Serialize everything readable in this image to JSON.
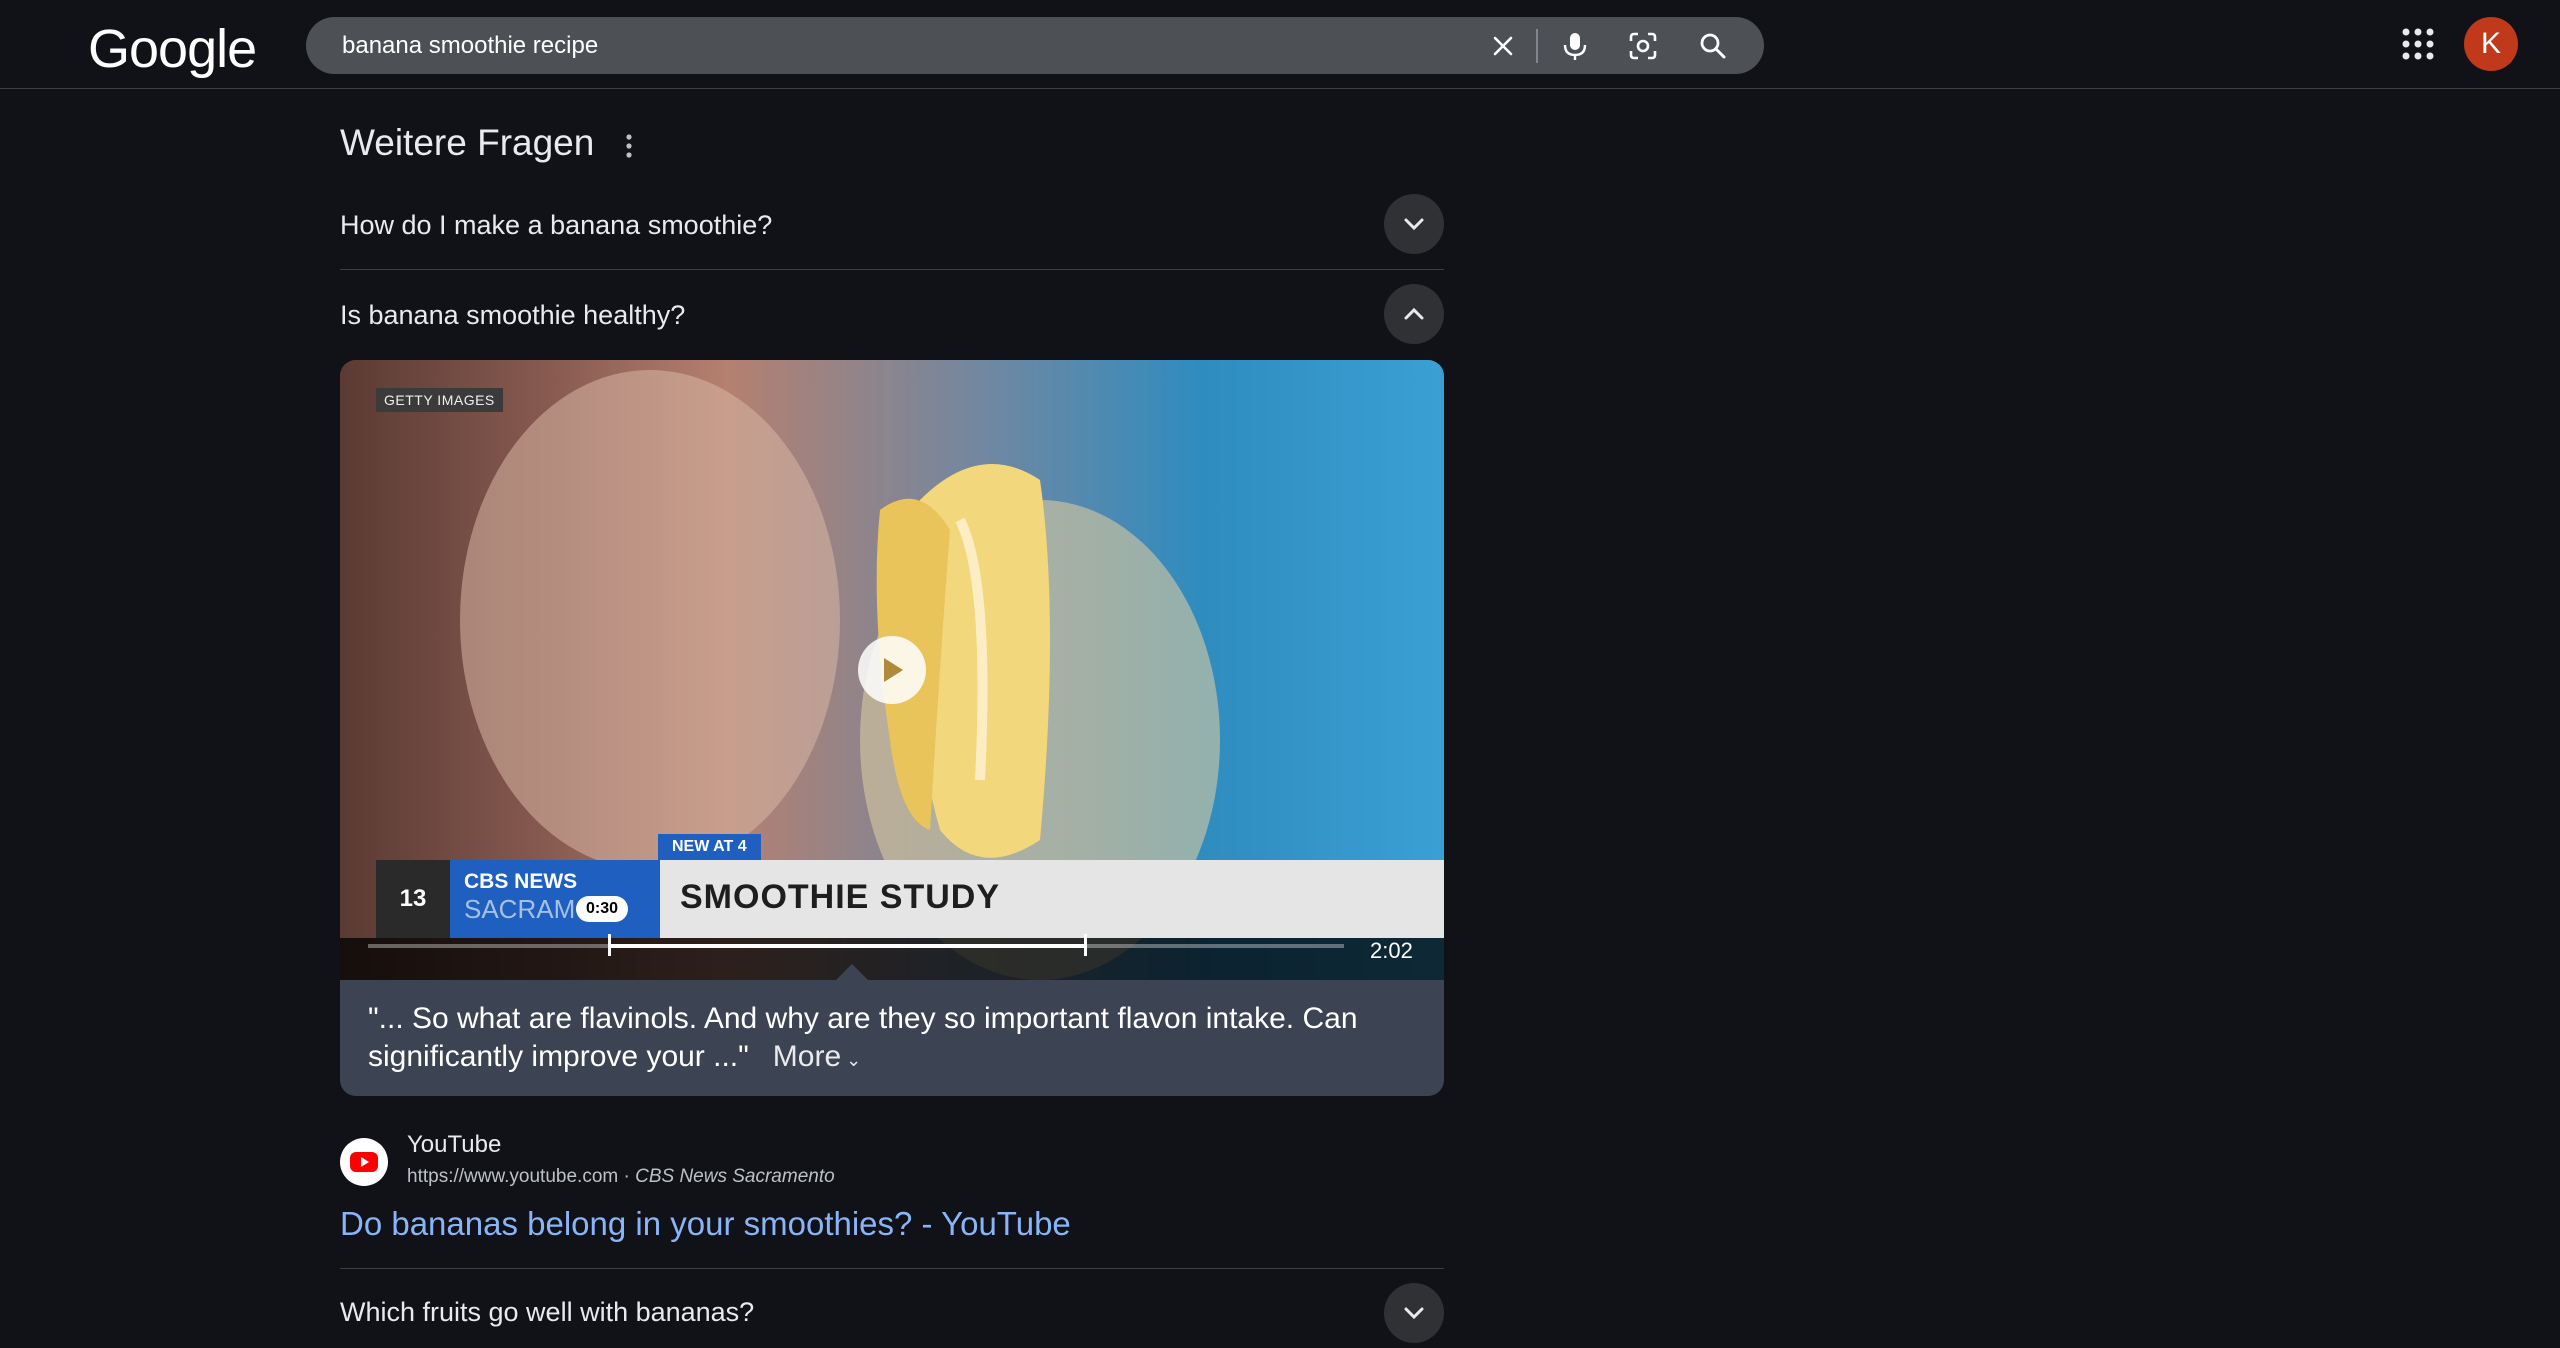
{
  "header": {
    "logo": "Google",
    "search_query": "banana smoothie recipe",
    "avatar_letter": "K"
  },
  "paa": {
    "title": "Weitere Fragen",
    "questions": [
      {
        "text": "How do I make a banana smoothie?",
        "state": "collapsed"
      },
      {
        "text": "Is banana smoothie healthy?",
        "state": "expanded"
      },
      {
        "text": "Which fruits go well with bananas?",
        "state": "collapsed"
      }
    ]
  },
  "video": {
    "getty_label": "GETTY IMAGES",
    "station_logo": "13",
    "network_line1": "CBS NEWS",
    "network_line2": "SACRAM",
    "tag": "NEW AT 4",
    "headline": "SMOOTHIE STUDY",
    "time_marker": "0:30",
    "duration": "2:02",
    "quote": "\"... So what are flavinols. And why are they so important flavon intake. Can significantly improve your ...\"",
    "more_label": "More"
  },
  "source": {
    "name": "YouTube",
    "url": "https://www.youtube.com",
    "separator": " · ",
    "author": "CBS News Sacramento",
    "title": "Do bananas belong in your smoothies? - YouTube"
  },
  "colors": {
    "background": "#101218",
    "link": "#8ab4f8",
    "avatar": "#c0391b",
    "search_box": "#4d5156"
  }
}
